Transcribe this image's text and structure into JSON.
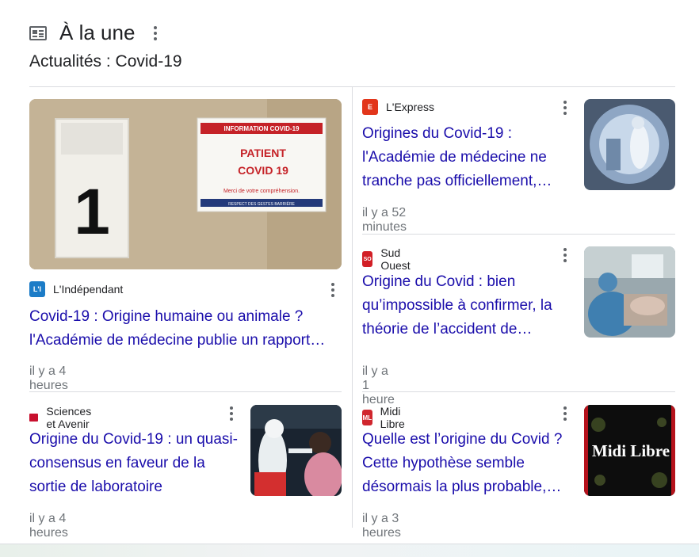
{
  "header": {
    "icon": "newspaper-icon",
    "title": "À la une",
    "subtitle": "Actualités : Covid-19"
  },
  "main_story": {
    "image": {
      "subject": "hospital-door-photo",
      "room_number": "1",
      "sign_banner": "INFORMATION COVID-19",
      "sign_line1": "PATIENT",
      "sign_line2": "COVID 19",
      "sign_note": "Merci de votre compréhension.",
      "sign_footer": "RESPECT DES GESTES BARRIÈRE"
    },
    "source": {
      "name": "L'Indépendant",
      "favicon": "L'I",
      "color": "#1c7cc7"
    },
    "headline": "Covid-19 : Origine humaine ou animale ? l'Académie de médecine publie un rapport…",
    "time": "il y a 4 heures"
  },
  "bottom_left_story": {
    "source": {
      "name": "Sciences et Avenir",
      "favicon": "S&A",
      "color": "#c8102e"
    },
    "headline": "Origine du Covid-19 : un quasi-consensus en faveur de la sortie de laboratoire",
    "time": "il y a 4 heures"
  },
  "right_stories": [
    {
      "source": {
        "name": "L'Express",
        "favicon": "E",
        "color": "#e2361b"
      },
      "headline": "Origines du Covid-19 : l'Académie de médecine ne tranche pas officiellement,…",
      "time": "il y a 52 minutes"
    },
    {
      "source": {
        "name": "Sud Ouest",
        "favicon": "SO",
        "color": "#d21f26"
      },
      "headline": "Origine du Covid : bien qu’impossible à confirmer, la théorie de l’accident de…",
      "time": "il y a 1 heure"
    },
    {
      "source": {
        "name": "Midi Libre",
        "favicon": "ML",
        "color": "#d0262d"
      },
      "headline": "Quelle est l’origine du Covid ? Cette hypothèse semble désormais la plus probable,…",
      "time": "il y a 3 heures",
      "thumb_text": "Midi Libre"
    }
  ]
}
